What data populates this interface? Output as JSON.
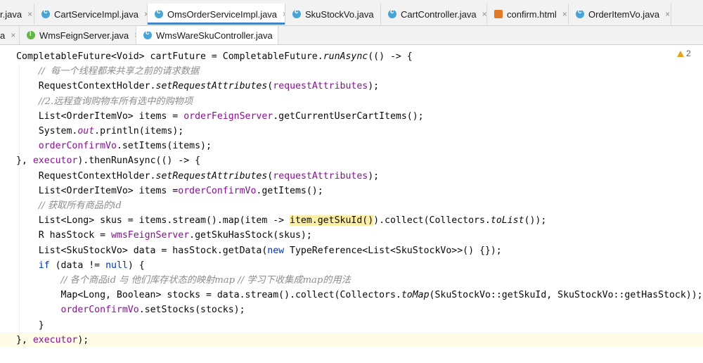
{
  "tabs_row1": [
    {
      "label": "r.java",
      "icon": "interface-icon"
    },
    {
      "label": "CartServiceImpl.java",
      "icon": "class-icon"
    },
    {
      "label": "OmsOrderServiceImpl.java",
      "icon": "class-icon",
      "active": true
    },
    {
      "label": "SkuStockVo.java",
      "icon": "class-icon"
    },
    {
      "label": "CartController.java",
      "icon": "class-icon"
    },
    {
      "label": "confirm.html",
      "icon": "html-icon"
    },
    {
      "label": "OrderItemVo.java",
      "icon": "class-icon"
    }
  ],
  "tabs_row2": [
    {
      "label": "a",
      "icon": ""
    },
    {
      "label": "WmsFeignServer.java",
      "icon": "interface-icon"
    },
    {
      "label": "WmsWareSkuController.java",
      "icon": "class-icon",
      "active": true
    }
  ],
  "close_glyph": "×",
  "warnings": {
    "count": "2"
  },
  "code_lines": [
    "CompletableFuture<Void> cartFuture = CompletableFuture.runAsync(() -> {",
    "    //  每一个线程都来共享之前的请求数据",
    "    RequestContextHolder.setRequestAttributes(requestAttributes);",
    "    //2.远程查询购物车所有选中的购物项",
    "    List<OrderItemVo> items = orderFeignServer.getCurrentUserCartItems();",
    "    System.out.println(items);",
    "    orderConfirmVo.setItems(items);",
    "}, executor).thenRunAsync(() -> {",
    "    RequestContextHolder.setRequestAttributes(requestAttributes);",
    "    List<OrderItemVo> items =orderConfirmVo.getItems();",
    "    // 获取所有商品的id",
    "    List<Long> skus = items.stream().map(item -> item.getSkuId()).collect(Collectors.toList());",
    "    R hasStock = wmsFeignServer.getSkuHasStock(skus);",
    "    List<SkuStockVo> data = hasStock.getData(new TypeReference<List<SkuStockVo>>() {});",
    "    if (data != null) {",
    "        // 各个商品id 与 他们库存状态的映射map // 学习下收集成map的用法",
    "        Map<Long, Boolean> stocks = data.stream().collect(Collectors.toMap(SkuStockVo::getSkuId, SkuStockVo::getHasStock));",
    "        orderConfirmVo.setStocks(stocks);",
    "    }",
    "}, executor);"
  ]
}
